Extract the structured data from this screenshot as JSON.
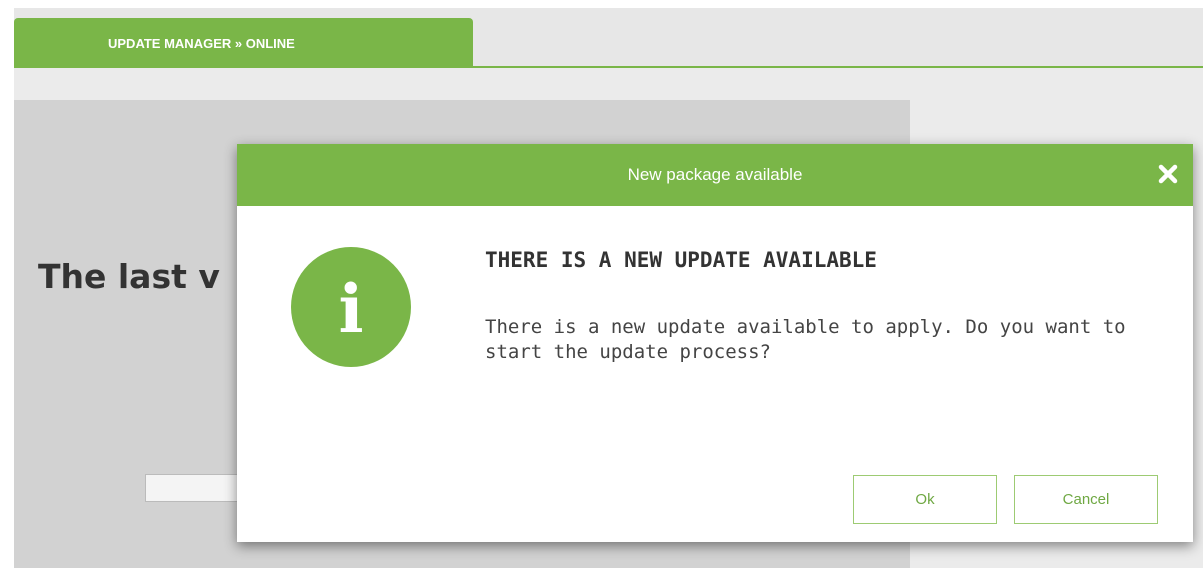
{
  "tabs": [
    {
      "label": "UPDATE MANAGER » ONLINE",
      "active": true
    }
  ],
  "background": {
    "title_fragment": "The last v"
  },
  "dialog": {
    "title": "New package available",
    "close_icon": "close-icon",
    "info_icon": "info-icon",
    "info_glyph": "i",
    "heading": "THERE IS A NEW UPDATE AVAILABLE",
    "message": "There is a new update available to apply. Do you want to start the update process?",
    "buttons": {
      "ok_label": "Ok",
      "cancel_label": "Cancel"
    }
  },
  "colors": {
    "accent": "#7ab648",
    "text_dark": "#333333",
    "background_gray": "#e7e7e7"
  }
}
